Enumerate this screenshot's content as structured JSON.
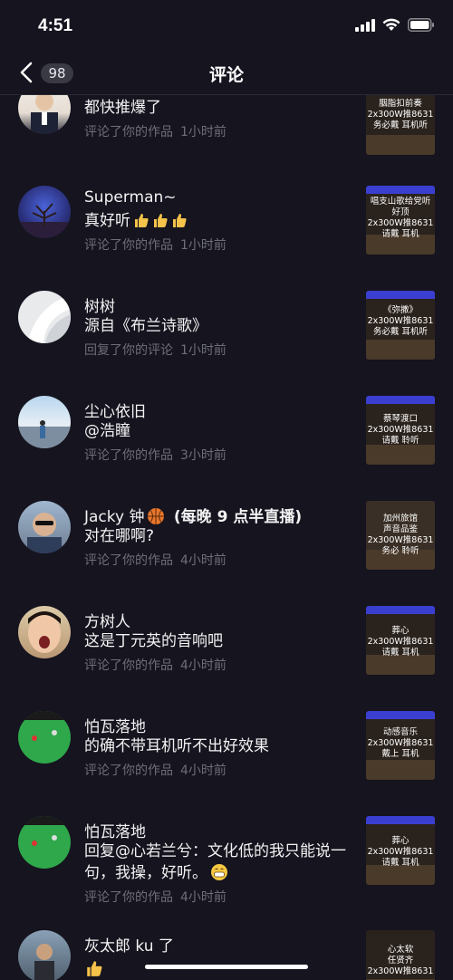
{
  "status": {
    "time": "4:51"
  },
  "nav": {
    "title": "评论",
    "count": "98"
  },
  "items": [
    {
      "name": "",
      "text": "都快推爆了",
      "action": "评论了你的作品",
      "time": "1小时前",
      "thumb": [
        "胭脂扣前奏",
        "2x300W推8631",
        "务必戴    耳机听"
      ]
    },
    {
      "name": "Superman~",
      "text": "真好听",
      "action": "评论了你的作品",
      "time": "1小时前",
      "thumb": [
        "唱支山歌给党听",
        "好顶",
        "2x300W推8631",
        "请戴    耳机"
      ]
    },
    {
      "name": "树树",
      "text": "源自《布兰诗歌》",
      "action": "回复了你的评论",
      "time": "1小时前",
      "thumb": [
        "《弥撒》",
        "2x300W推8631",
        "务必戴    耳机听"
      ]
    },
    {
      "name": "尘心依旧",
      "text": "@浩瞳",
      "action": "评论了你的作品",
      "time": "3小时前",
      "thumb": [
        "蔡琴渡口",
        "2x300W推8631",
        "请戴    聆听"
      ]
    },
    {
      "name": "Jacky 钟",
      "name_suffix": "(每晚 9 点半直播)",
      "text": "对在哪啊?",
      "action": "评论了你的作品",
      "time": "4小时前",
      "thumb": [
        "加州旅馆",
        "声音品鉴",
        "2x300W推8631",
        "务必    聆听"
      ]
    },
    {
      "name": "方树人",
      "text": "这是丁元英的音响吧",
      "action": "评论了你的作品",
      "time": "4小时前",
      "thumb": [
        "葬心",
        "2x300W推8631",
        "请戴    耳机"
      ]
    },
    {
      "name": "怕瓦落地",
      "text": "的确不带耳机听不出好效果",
      "action": "评论了你的作品",
      "time": "4小时前",
      "thumb": [
        "动感音乐",
        "2x300W推8631",
        "戴上    耳机"
      ]
    },
    {
      "name": "怕瓦落地",
      "text": "回复@心若兰兮：文化低的我只能说一句，我操，好听。",
      "action": "评论了你的作品",
      "time": "4小时前",
      "thumb": [
        "葬心",
        "2x300W推8631",
        "请戴    耳机"
      ]
    },
    {
      "name": "灰太郎 ku 了",
      "text": "",
      "action": "",
      "time": "",
      "thumb": [
        "心太软",
        "任贤齐",
        "2x300W推8631"
      ]
    }
  ]
}
